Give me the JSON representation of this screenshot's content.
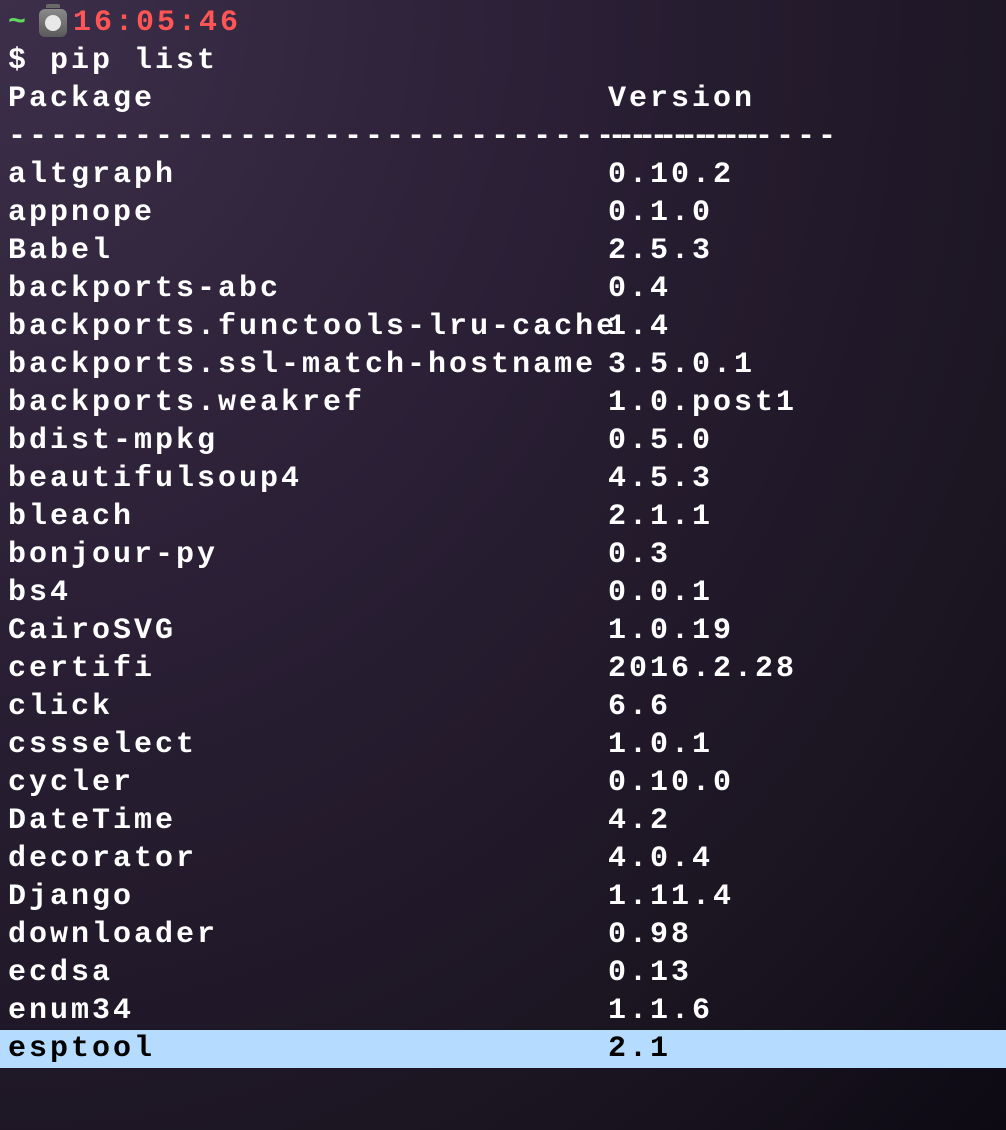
{
  "prompt": {
    "cwd_symbol": "~",
    "timestamp": "16:05:46",
    "prompt_char": "$",
    "command": "pip list"
  },
  "headers": {
    "package": "Package",
    "version": "Version"
  },
  "dividers": {
    "package": "------------------------------------",
    "version": "-----------"
  },
  "packages": [
    {
      "name": "altgraph",
      "version": "0.10.2"
    },
    {
      "name": "appnope",
      "version": "0.1.0"
    },
    {
      "name": "Babel",
      "version": "2.5.3"
    },
    {
      "name": "backports-abc",
      "version": "0.4"
    },
    {
      "name": "backports.functools-lru-cache",
      "version": "1.4"
    },
    {
      "name": "backports.ssl-match-hostname",
      "version": "3.5.0.1"
    },
    {
      "name": "backports.weakref",
      "version": "1.0.post1"
    },
    {
      "name": "bdist-mpkg",
      "version": "0.5.0"
    },
    {
      "name": "beautifulsoup4",
      "version": "4.5.3"
    },
    {
      "name": "bleach",
      "version": "2.1.1"
    },
    {
      "name": "bonjour-py",
      "version": "0.3"
    },
    {
      "name": "bs4",
      "version": "0.0.1"
    },
    {
      "name": "CairoSVG",
      "version": "1.0.19"
    },
    {
      "name": "certifi",
      "version": "2016.2.28"
    },
    {
      "name": "click",
      "version": "6.6"
    },
    {
      "name": "cssselect",
      "version": "1.0.1"
    },
    {
      "name": "cycler",
      "version": "0.10.0"
    },
    {
      "name": "DateTime",
      "version": "4.2"
    },
    {
      "name": "decorator",
      "version": "4.0.4"
    },
    {
      "name": "Django",
      "version": "1.11.4"
    },
    {
      "name": "downloader",
      "version": "0.98"
    },
    {
      "name": "ecdsa",
      "version": "0.13"
    },
    {
      "name": "enum34",
      "version": "1.1.6"
    },
    {
      "name": "esptool",
      "version": "2.1",
      "highlighted": true
    }
  ]
}
